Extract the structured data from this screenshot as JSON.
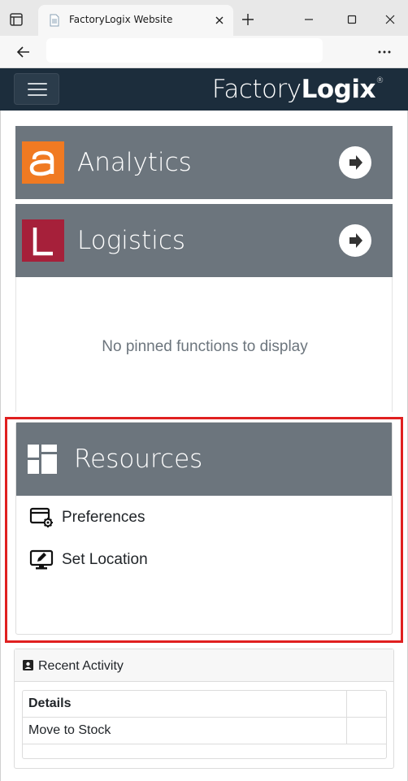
{
  "browser": {
    "tab_title": "FactoryLogix Website",
    "url": ""
  },
  "navbar": {
    "brand_light": "Factory",
    "brand_bold": "Logix",
    "brand_mark": "®"
  },
  "modules": [
    {
      "title": "Analytics",
      "logo_letter": "a",
      "logo_color": "#f07a22"
    },
    {
      "title": "Logistics",
      "logo_letter": "L",
      "logo_color": "#a6203a"
    }
  ],
  "pinned": {
    "empty_text": "No pinned functions to display"
  },
  "resources": {
    "title": "Resources",
    "items": [
      {
        "label": "Preferences",
        "icon": "preferences-window-gear-icon"
      },
      {
        "label": "Set Location",
        "icon": "monitor-pencil-icon"
      }
    ]
  },
  "recent_activity": {
    "title": "Recent Activity",
    "icon": "contact-card-icon",
    "columns": [
      "Details"
    ],
    "rows": [
      "Move to Stock"
    ]
  },
  "colors": {
    "navbar": "#1c2d3c",
    "card_header": "#6c757d",
    "highlight": "#e02020"
  }
}
